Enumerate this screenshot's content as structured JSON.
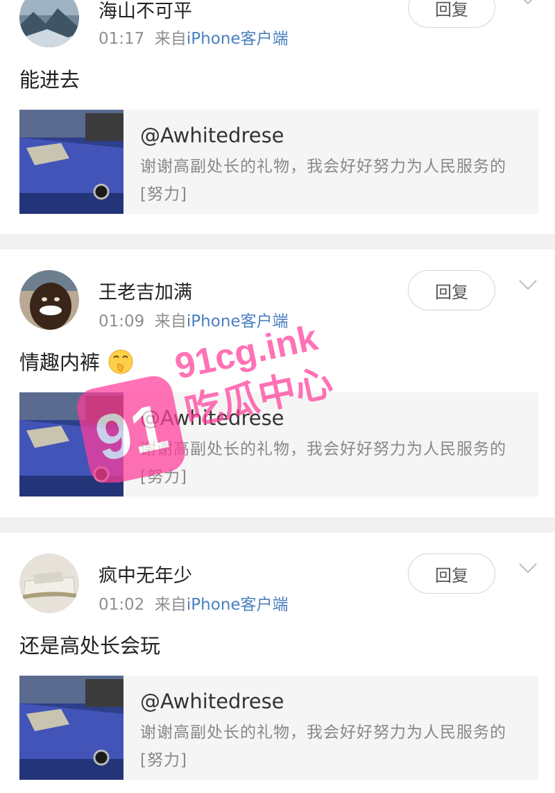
{
  "comments": [
    {
      "name": "海山不可平",
      "time": "01:17",
      "from": "来自",
      "source": "iPhone客户端",
      "reply": "回复",
      "text": "能进去",
      "emoji": "",
      "quote": {
        "handle": "@Awhitedrese",
        "body": "谢谢高副处长的礼物，我会好好努力为人民服务的[努力]"
      }
    },
    {
      "name": "王老吉加满",
      "time": "01:09",
      "from": "来自",
      "source": "iPhone客户端",
      "reply": "回复",
      "text": "情趣内裤",
      "emoji": "shushing-face-emoji",
      "quote": {
        "handle": "@Awhitedrese",
        "body": "谢谢高副处长的礼物，我会好好努力为人民服务的[努力]"
      }
    },
    {
      "name": "疯中无年少",
      "time": "01:02",
      "from": "来自",
      "source": "iPhone客户端",
      "reply": "回复",
      "text": "还是高处长会玩",
      "emoji": "",
      "quote": {
        "handle": "@Awhitedrese",
        "body": "谢谢高副处长的礼物，我会好好努力为人民服务的[努力]"
      }
    }
  ],
  "watermark": {
    "line1": "91cg.ink",
    "line2": "吃瓜中心",
    "logo": "91",
    "color": "#ff3d9a"
  },
  "colors": {
    "source_link": "#4a7fbf",
    "separator": "#f1f1f1",
    "quote_bg": "#f5f5f5"
  }
}
